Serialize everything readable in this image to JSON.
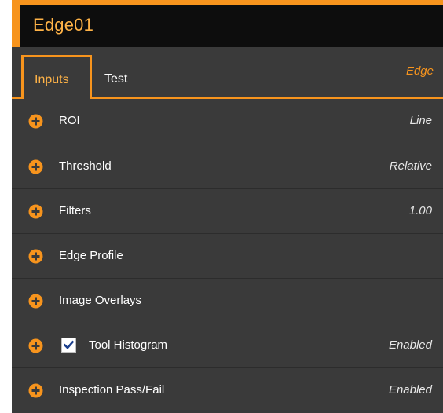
{
  "header": {
    "title": "Edge01"
  },
  "tabs": [
    {
      "label": "Inputs",
      "active": true
    },
    {
      "label": "Test",
      "active": false
    }
  ],
  "tool_type": "Edge",
  "rows": [
    {
      "label": "ROI",
      "value": "Line",
      "icon": "plus-circle-icon"
    },
    {
      "label": "Threshold",
      "value": "Relative",
      "icon": "plus-circle-icon"
    },
    {
      "label": "Filters",
      "value": "1.00",
      "icon": "plus-circle-icon"
    },
    {
      "label": "Edge Profile",
      "value": "",
      "icon": "plus-circle-icon"
    },
    {
      "label": "Image Overlays",
      "value": "",
      "icon": "plus-circle-icon"
    },
    {
      "label": "Tool Histogram",
      "value": "Enabled",
      "icon": "plus-circle-icon",
      "checkbox": true,
      "checked": true
    },
    {
      "label": "Inspection Pass/Fail",
      "value": "Enabled",
      "icon": "plus-circle-icon"
    }
  ],
  "colors": {
    "accent": "#f7941d",
    "panel": "#3a3a3a",
    "title_bar": "#0d0d0d",
    "title_text": "#ffb347"
  }
}
